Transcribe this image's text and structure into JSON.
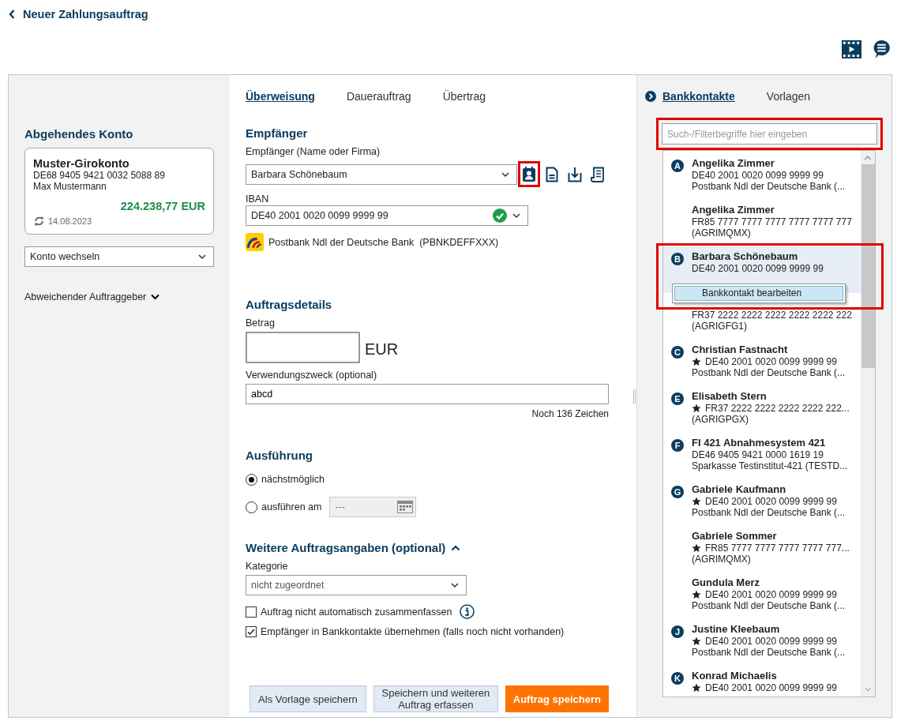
{
  "header": {
    "title": "Neuer Zahlungsauftrag"
  },
  "top_icons": [
    {
      "kind": "video"
    },
    {
      "kind": "chat"
    }
  ],
  "source_account": {
    "heading": "Abgehendes Konto",
    "name": "Muster-Girokonto",
    "iban": "DE68 9405 9421 0032 5088 89",
    "holder": "Max Mustermann",
    "balance": "224.238,77 EUR",
    "updated": "14.08.2023",
    "switch_value": "Konto wechseln",
    "alt_payer": {
      "label": "Abweichender Auftraggeber",
      "expanded": false
    }
  },
  "order_tabs": [
    {
      "label": "Überweisung",
      "selected": true
    },
    {
      "label": "Dauerauftrag",
      "selected": false
    },
    {
      "label": "Übertrag",
      "selected": false
    }
  ],
  "recipient": {
    "heading": "Empfänger",
    "name_label": "Empfänger (Name oder Firma)",
    "name_value": "Barbara Schönebaum",
    "tools": [
      {
        "kind": "contacts",
        "highlighted": true
      },
      {
        "kind": "document",
        "highlighted": false
      },
      {
        "kind": "import",
        "highlighted": false
      },
      {
        "kind": "receipt",
        "highlighted": false
      }
    ],
    "iban_label": "IBAN",
    "iban_value": "DE40 2001 0020 0099 9999 99",
    "iban_valid": true,
    "bank": "Postbank Ndl der Deutsche Bank",
    "bic": "(PBNKDEFFXXX)"
  },
  "details": {
    "heading": "Auftragsdetails",
    "amount_label": "Betrag",
    "currency": "EUR",
    "purpose_label": "Verwendungszweck (optional)",
    "purpose_value": "abcd",
    "remaining": "Noch 136 Zeichen"
  },
  "execution": {
    "heading": "Ausführung",
    "options": [
      {
        "label": "nächstmöglich",
        "selected": true,
        "kind": "plain"
      },
      {
        "label": "ausführen am",
        "selected": false,
        "kind": "date",
        "date_value": "---"
      }
    ]
  },
  "more": {
    "heading": "Weitere Auftragsangaben (optional)",
    "expanded": true,
    "category_label": "Kategorie",
    "category_value": "nicht zugeordnet",
    "checkboxes": [
      {
        "label": "Auftrag nicht automatisch zusammenfassen",
        "checked": false,
        "info": true
      },
      {
        "label": "Empfänger in Bankkontakte übernehmen (falls noch nicht vorhanden)",
        "checked": true,
        "info": false
      }
    ]
  },
  "buttons": [
    {
      "label": "Als Vorlage speichern",
      "kind": "secondary"
    },
    {
      "label": "Speichern und weiteren Auftrag erfassen",
      "kind": "secondary"
    },
    {
      "label": "Auftrag speichern",
      "kind": "primary"
    }
  ],
  "side_tabs": [
    {
      "label": "Bankkontakte",
      "selected": true
    },
    {
      "label": "Vorlagen",
      "selected": false
    }
  ],
  "search": {
    "placeholder": "Such-/Filterbegriffe hier eingeben",
    "highlighted": true
  },
  "contacts": [
    {
      "letter": "A",
      "name": "Angelika Zimmer",
      "favorite": false,
      "iban": "DE40 2001 0020 0099 9999 99",
      "bank": "Postbank Ndl der Deutsche Bank (...",
      "selected": false,
      "highlighted": false
    },
    {
      "name": "Angelika Zimmer",
      "favorite": false,
      "iban": "FR85 7777 7777 7777 7777 7777 777",
      "bank": "(AGRIMQMX)",
      "selected": false,
      "highlighted": false
    },
    {
      "letter": "B",
      "name": "Barbara Schönebaum",
      "favorite": false,
      "iban": "DE40 2001 0020 0099 9999 99",
      "selected": true,
      "highlighted": true,
      "context_menu": [
        "Bankkontakt bearbeiten"
      ]
    },
    {
      "favorite": false,
      "iban": "FR37 2222 2222 2222 2222 2222 222",
      "bank": "(AGRIGFG1)",
      "selected": false,
      "highlighted": false
    },
    {
      "letter": "C",
      "name": "Christian Fastnacht",
      "favorite": true,
      "iban": "DE40 2001 0020 0099 9999 99",
      "bank": "Postbank Ndl der Deutsche Bank (...",
      "selected": false,
      "highlighted": false
    },
    {
      "letter": "E",
      "name": "Elisabeth Stern",
      "favorite": true,
      "iban": "FR37 2222 2222 2222 2222 222...",
      "bank": "(AGRIGPGX)",
      "selected": false,
      "highlighted": false
    },
    {
      "letter": "F",
      "name": "FI 421 Abnahmesystem 421",
      "favorite": false,
      "iban": "DE46 9405 9421 0000 1619 19",
      "bank": "Sparkasse Testinstitut-421 (TESTD...",
      "selected": false,
      "highlighted": false
    },
    {
      "letter": "G",
      "name": "Gabriele Kaufmann",
      "favorite": true,
      "iban": "DE40 2001 0020 0099 9999 99",
      "bank": "Postbank Ndl der Deutsche Bank (...",
      "selected": false,
      "highlighted": false
    },
    {
      "name": "Gabriele Sommer",
      "favorite": true,
      "iban": "FR85 7777 7777 7777 7777 777...",
      "bank": "(AGRIMQMX)",
      "selected": false,
      "highlighted": false
    },
    {
      "name": "Gundula Merz",
      "favorite": true,
      "iban": "DE40 2001 0020 0099 9999 99",
      "bank": "Postbank Ndl der Deutsche Bank (...",
      "selected": false,
      "highlighted": false
    },
    {
      "letter": "J",
      "name": "Justine Kleebaum",
      "favorite": true,
      "iban": "DE40 2001 0020 0099 9999 99",
      "bank": "Postbank Ndl der Deutsche Bank (...",
      "selected": false,
      "highlighted": false
    },
    {
      "letter": "K",
      "name": "Konrad Michaelis",
      "favorite": true,
      "iban": "DE40 2001 0020 0099 9999 99",
      "selected": false,
      "highlighted": false
    }
  ]
}
